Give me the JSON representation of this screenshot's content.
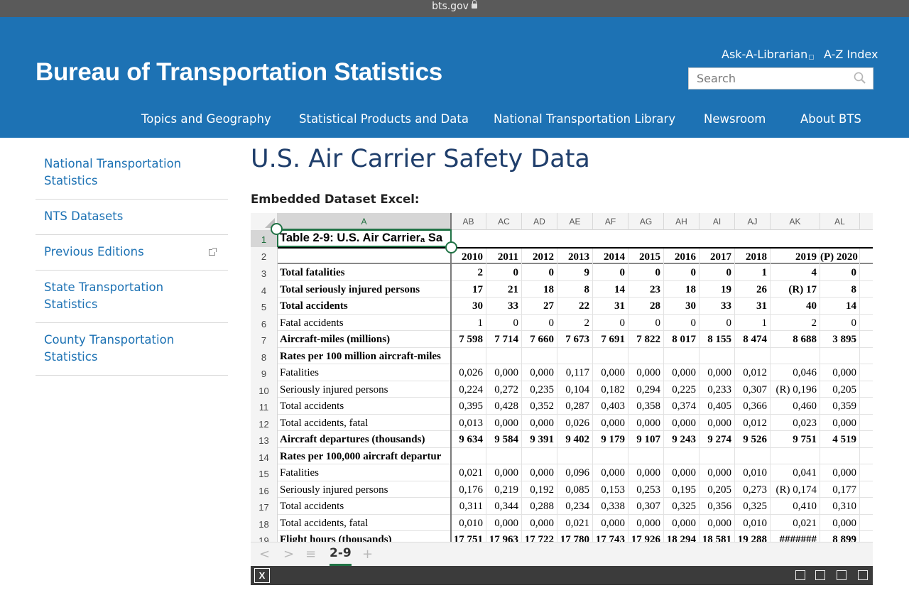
{
  "browser": {
    "url": "bts.gov"
  },
  "header": {
    "site_title": "Bureau of Transportation Statistics",
    "ask_librarian": "Ask-A-Librarian",
    "az_index": "A-Z Index",
    "search_placeholder": "Search",
    "nav": [
      "Topics and Geography",
      "Statistical Products and Data",
      "National Transportation Library",
      "Newsroom",
      "About BTS"
    ]
  },
  "sidebar": {
    "items": [
      {
        "label": "National Transportation Statistics",
        "external": false
      },
      {
        "label": "NTS Datasets",
        "external": false
      },
      {
        "label": "Previous Editions",
        "external": true
      },
      {
        "label": "State Transportation Statistics",
        "external": false
      },
      {
        "label": "County Transportation Statistics",
        "external": false
      }
    ]
  },
  "main": {
    "title": "U.S. Air Carrier Safety Data",
    "embed_label": "Embedded Dataset Excel:"
  },
  "excel": {
    "selected_column": "A",
    "columns": [
      "A",
      "AB",
      "AC",
      "AD",
      "AE",
      "AF",
      "AG",
      "AH",
      "AI",
      "AJ",
      "AK",
      "AL"
    ],
    "table_title": "Table 2-9:  U.S. Air Carrierₐ Sa",
    "years": [
      "2010",
      "2011",
      "2012",
      "2013",
      "2014",
      "2015",
      "2016",
      "2017",
      "2018",
      "2019",
      "(P) 2020"
    ],
    "rows": [
      {
        "n": "3",
        "label": "Total fatalities",
        "bold": true,
        "values": [
          "2",
          "0",
          "0",
          "9",
          "0",
          "0",
          "0",
          "0",
          "1",
          "4",
          "0"
        ]
      },
      {
        "n": "4",
        "label": "Total seriously injured persons",
        "bold": true,
        "values": [
          "17",
          "21",
          "18",
          "8",
          "14",
          "23",
          "18",
          "19",
          "26",
          "(R) 17",
          "8"
        ]
      },
      {
        "n": "5",
        "label": "Total accidents",
        "bold": true,
        "values": [
          "30",
          "33",
          "27",
          "22",
          "31",
          "28",
          "30",
          "33",
          "31",
          "40",
          "14"
        ]
      },
      {
        "n": "6",
        "label": "Fatal accidents",
        "bold": false,
        "values": [
          "1",
          "0",
          "0",
          "2",
          "0",
          "0",
          "0",
          "0",
          "1",
          "2",
          "0"
        ]
      },
      {
        "n": "7",
        "label": "Aircraft-miles (millions)",
        "bold": true,
        "values": [
          "7 598",
          "7 714",
          "7 660",
          "7 673",
          "7 691",
          "7 822",
          "8 017",
          "8 155",
          "8 474",
          "8 688",
          "3 895"
        ]
      },
      {
        "n": "8",
        "label": "Rates per 100 million aircraft-miles",
        "bold": true,
        "values": [
          "",
          "",
          "",
          "",
          "",
          "",
          "",
          "",
          "",
          "",
          ""
        ]
      },
      {
        "n": "9",
        "label": "Fatalities",
        "bold": false,
        "values": [
          "0,026",
          "0,000",
          "0,000",
          "0,117",
          "0,000",
          "0,000",
          "0,000",
          "0,000",
          "0,012",
          "0,046",
          "0,000"
        ]
      },
      {
        "n": "10",
        "label": "Seriously injured persons",
        "bold": false,
        "values": [
          "0,224",
          "0,272",
          "0,235",
          "0,104",
          "0,182",
          "0,294",
          "0,225",
          "0,233",
          "0,307",
          "(R) 0,196",
          "0,205"
        ]
      },
      {
        "n": "11",
        "label": "Total accidents",
        "bold": false,
        "values": [
          "0,395",
          "0,428",
          "0,352",
          "0,287",
          "0,403",
          "0,358",
          "0,374",
          "0,405",
          "0,366",
          "0,460",
          "0,359"
        ]
      },
      {
        "n": "12",
        "label": "Total accidents, fatal",
        "bold": false,
        "values": [
          "0,013",
          "0,000",
          "0,000",
          "0,026",
          "0,000",
          "0,000",
          "0,000",
          "0,000",
          "0,012",
          "0,023",
          "0,000"
        ]
      },
      {
        "n": "13",
        "label": "Aircraft departures (thousands)",
        "bold": true,
        "values": [
          "9 634",
          "9 584",
          "9 391",
          "9 402",
          "9 179",
          "9 107",
          "9 243",
          "9 274",
          "9 526",
          "9 751",
          "4 519"
        ]
      },
      {
        "n": "14",
        "label": "Rates per 100,000 aircraft departur",
        "bold": true,
        "values": [
          "",
          "",
          "",
          "",
          "",
          "",
          "",
          "",
          "",
          "",
          ""
        ]
      },
      {
        "n": "15",
        "label": "Fatalities",
        "bold": false,
        "values": [
          "0,021",
          "0,000",
          "0,000",
          "0,096",
          "0,000",
          "0,000",
          "0,000",
          "0,000",
          "0,010",
          "0,041",
          "0,000"
        ]
      },
      {
        "n": "16",
        "label": "Seriously injured persons",
        "bold": false,
        "values": [
          "0,176",
          "0,219",
          "0,192",
          "0,085",
          "0,153",
          "0,253",
          "0,195",
          "0,205",
          "0,273",
          "(R) 0,174",
          "0,177"
        ]
      },
      {
        "n": "17",
        "label": "Total accidents",
        "bold": false,
        "values": [
          "0,311",
          "0,344",
          "0,288",
          "0,234",
          "0,338",
          "0,307",
          "0,325",
          "0,356",
          "0,325",
          "0,410",
          "0,310"
        ]
      },
      {
        "n": "18",
        "label": "Total accidents, fatal",
        "bold": false,
        "values": [
          "0,010",
          "0,000",
          "0,000",
          "0,021",
          "0,000",
          "0,000",
          "0,000",
          "0,000",
          "0,010",
          "0,021",
          "0,000"
        ]
      },
      {
        "n": "19",
        "label": "Flight hours (thousands)",
        "bold": true,
        "values": [
          "17 751",
          "17 963",
          "17 722",
          "17 780",
          "17 743",
          "17 926",
          "18 294",
          "18 581",
          "19 288",
          "#######",
          "8 899"
        ]
      }
    ],
    "sheet_tab": "2-9",
    "tab_controls": {
      "prev": "<",
      "next": ">",
      "menu": "≡",
      "add": "+"
    },
    "excel_logo": "X"
  }
}
